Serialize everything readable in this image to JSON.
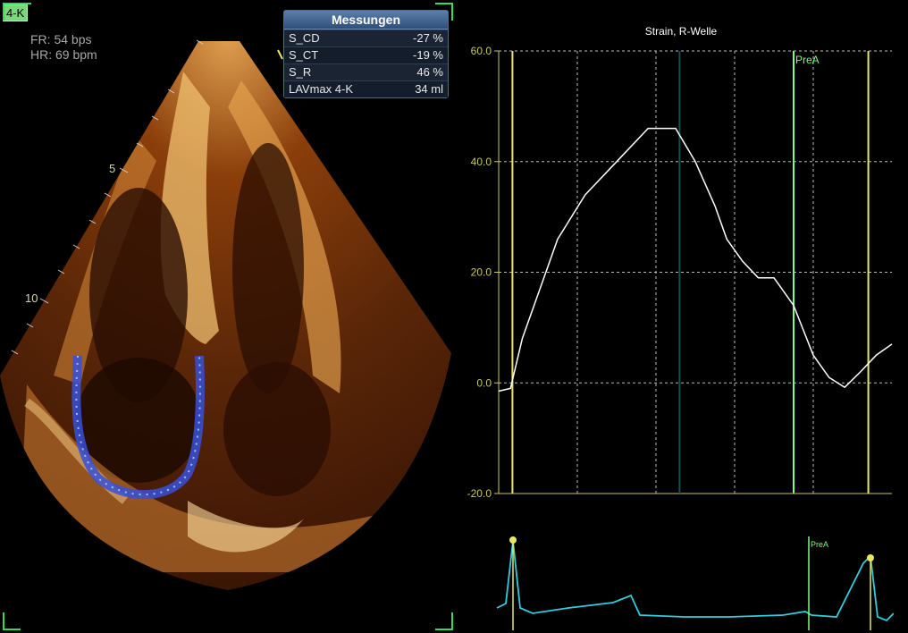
{
  "view_label": "4-K",
  "frame_rate": "FR: 54 bps",
  "heart_rate": "HR: 69 bpm",
  "depth_markers": [
    "5",
    "10"
  ],
  "measurements": {
    "title": "Messungen",
    "rows": [
      {
        "name": "S_CD",
        "value": "-27 %"
      },
      {
        "name": "S_CT",
        "value": "-19 %"
      },
      {
        "name": "S_R",
        "value": "46 %"
      },
      {
        "name": "LAVmax 4-K",
        "value": "34 ml"
      }
    ]
  },
  "chart_data": {
    "type": "line",
    "title": "Strain, R-Welle",
    "ylim": [
      -20,
      60
    ],
    "yticks": [
      "60.0",
      "40.0",
      "20.0",
      "0.0",
      "-20.0"
    ],
    "grid": true,
    "series": [
      {
        "color": "#ffffff",
        "x": [
          0,
          3,
          6,
          10,
          15,
          22,
          30,
          38,
          45,
          50,
          55,
          58,
          62,
          66,
          70,
          75,
          80,
          84,
          88,
          92,
          96,
          100
        ],
        "y": [
          -1.5,
          -1,
          8,
          16,
          26,
          34,
          40,
          46,
          46,
          40,
          32,
          26,
          22,
          19,
          19,
          14,
          5,
          1,
          -0.8,
          2,
          5,
          7
        ]
      }
    ],
    "markers": [
      {
        "x": 3.5,
        "color": "#e8e860"
      },
      {
        "x": 46,
        "color": "#1a4d4d"
      },
      {
        "x": 75,
        "color": "#7dff7d",
        "label": "PreA"
      },
      {
        "x": 94,
        "color": "#e8e860"
      }
    ]
  },
  "ecg": {
    "color": "#33ccdd",
    "label": "PreA",
    "marker_color": "#e8e860"
  }
}
